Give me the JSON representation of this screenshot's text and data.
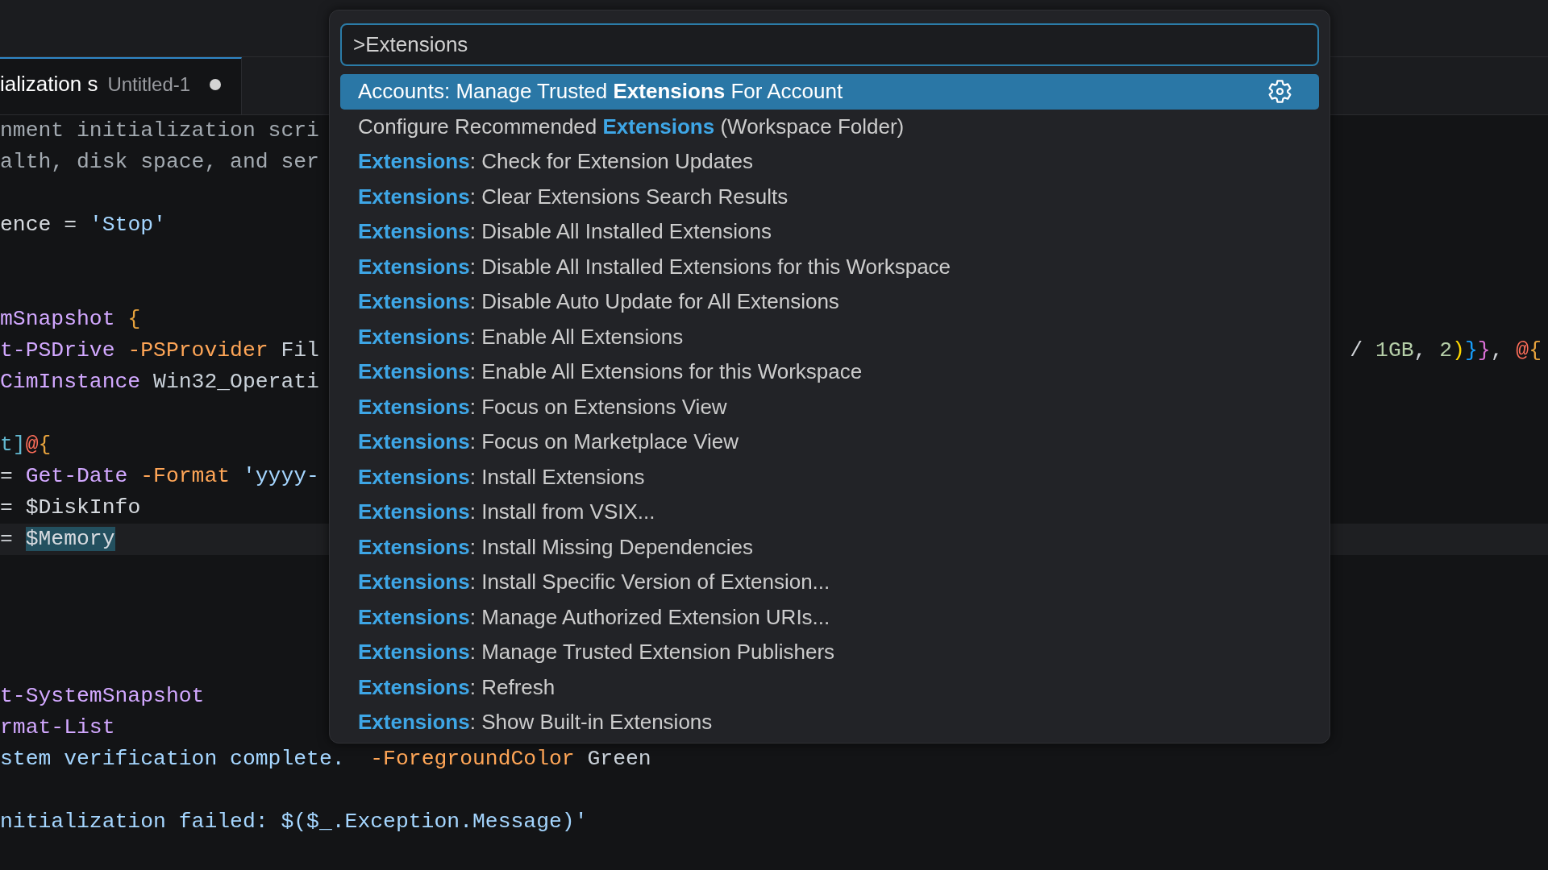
{
  "tabs": [
    {
      "title": "ialization s",
      "description": "Untitled-1",
      "dirty": true,
      "selected": true
    }
  ],
  "editor": {
    "lines": [
      {
        "tokens": [
          {
            "text": "nment initialization scri",
            "kind": "comment"
          }
        ],
        "current": false
      },
      {
        "tokens": [
          {
            "text": "alth, disk space, and ser",
            "kind": "comment"
          }
        ],
        "current": false
      },
      {
        "current": false
      },
      {
        "tokens": [
          {
            "text": "ence",
            "kind": "variable"
          },
          {
            "text": " = ",
            "kind": "punctuation"
          },
          {
            "text": "'Stop'",
            "kind": "string"
          }
        ],
        "current": false
      },
      {
        "current": false
      },
      {
        "current": false
      },
      {
        "tokens": [
          {
            "text": "mSnapshot ",
            "kind": "command"
          },
          {
            "text": "{",
            "kind": "brace"
          }
        ],
        "current": false
      },
      {
        "tokens": [
          {
            "text": "t-PSDrive ",
            "kind": "command"
          },
          {
            "text": "-PSProvider",
            "kind": "parameter"
          },
          {
            "text": " Fil",
            "kind": "plain"
          }
        ],
        "tail": [
          {
            "text": "/ ",
            "kind": "punctuation"
          },
          {
            "text": "1GB",
            "kind": "number"
          },
          {
            "text": ", ",
            "kind": "punctuation"
          },
          {
            "text": "2",
            "kind": "number"
          },
          {
            "text": ")",
            "kind": "bracket-1"
          },
          {
            "text": "}",
            "kind": "bracket-2"
          },
          {
            "text": "}",
            "kind": "bracket-3"
          },
          {
            "text": ", ",
            "kind": "punctuation"
          },
          {
            "text": "@",
            "kind": "operator"
          },
          {
            "text": "{",
            "kind": "brace"
          }
        ],
        "current": false
      },
      {
        "tokens": [
          {
            "text": "CimInstance",
            "kind": "command"
          },
          {
            "text": " Win32_Operati",
            "kind": "plain"
          }
        ],
        "current": false
      },
      {
        "current": false
      },
      {
        "tokens": [
          {
            "text": "t]",
            "kind": "type"
          },
          {
            "text": "@",
            "kind": "operator"
          },
          {
            "text": "{",
            "kind": "brace"
          }
        ],
        "current": false
      },
      {
        "tokens": [
          {
            "text": "= ",
            "kind": "punctuation"
          },
          {
            "text": "Get-Date",
            "kind": "command"
          },
          {
            "text": " -Format",
            "kind": "parameter"
          },
          {
            "text": " 'yyyy-",
            "kind": "string"
          }
        ],
        "current": false
      },
      {
        "tokens": [
          {
            "text": "= ",
            "kind": "punctuation"
          },
          {
            "text": "$DiskInfo",
            "kind": "variable"
          }
        ],
        "current": false
      },
      {
        "tokens": [
          {
            "text": "= ",
            "kind": "punctuation"
          },
          {
            "text": "$Memory",
            "kind": "selection"
          }
        ],
        "current": true
      },
      {
        "current": false
      },
      {
        "current": false
      },
      {
        "current": false
      },
      {
        "current": false
      },
      {
        "tokens": [
          {
            "text": "t-SystemSnapshot",
            "kind": "command"
          }
        ],
        "current": false
      },
      {
        "tokens": [
          {
            "text": "rmat-List",
            "kind": "command"
          }
        ],
        "current": false
      },
      {
        "tokens": [
          {
            "text": "stem verification complete.",
            "kind": "string"
          },
          {
            "text": "  -ForegroundColor",
            "kind": "parameter"
          },
          {
            "text": " Green",
            "kind": "plain"
          }
        ],
        "current": false
      },
      {
        "current": false
      },
      {
        "tokens": [
          {
            "text": "nitialization failed: $($_.Exception.Message)'",
            "kind": "string"
          }
        ],
        "current": false
      }
    ]
  },
  "command_palette": {
    "input": {
      "value": ">Extensions"
    },
    "items": [
      {
        "label": "Accounts: Manage Trusted **Extensions** For Account",
        "selected": true
      },
      {
        "label": "Configure Recommended **Extensions** (Workspace Folder)",
        "selected": false
      },
      {
        "label": "**Extensions**: Check for Extension Updates",
        "selected": false
      },
      {
        "label": "**Extensions**: Clear Extensions Search Results",
        "selected": false
      },
      {
        "label": "**Extensions**: Disable All Installed Extensions",
        "selected": false
      },
      {
        "label": "**Extensions**: Disable All Installed Extensions for this Workspace",
        "selected": false
      },
      {
        "label": "**Extensions**: Disable Auto Update for All Extensions",
        "selected": false
      },
      {
        "label": "**Extensions**: Enable All Extensions",
        "selected": false
      },
      {
        "label": "**Extensions**: Enable All Extensions for this Workspace",
        "selected": false
      },
      {
        "label": "**Extensions**: Focus on Extensions View",
        "selected": false
      },
      {
        "label": "**Extensions**: Focus on Marketplace View",
        "selected": false
      },
      {
        "label": "**Extensions**: Install Extensions",
        "selected": false
      },
      {
        "label": "**Extensions**: Install from VSIX...",
        "selected": false
      },
      {
        "label": "**Extensions**: Install Missing Dependencies",
        "selected": false
      },
      {
        "label": "**Extensions**: Install Specific Version of Extension...",
        "selected": false
      },
      {
        "label": "**Extensions**: Manage Authorized Extension URIs...",
        "selected": false
      },
      {
        "label": "**Extensions**: Manage Trusted Extension Publishers",
        "selected": false
      },
      {
        "label": "**Extensions**: Refresh",
        "selected": false
      },
      {
        "label": "**Extensions**: Show Built-in Extensions",
        "selected": false
      }
    ]
  }
}
